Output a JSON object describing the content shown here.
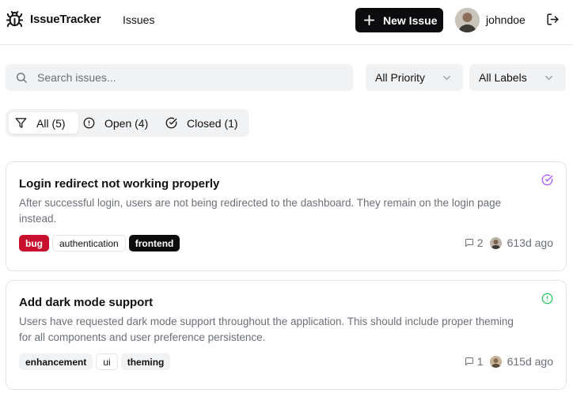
{
  "app": {
    "name": "IssueTracker",
    "nav_issues": "Issues"
  },
  "header": {
    "new_issue_label": "New Issue",
    "username": "johndoe"
  },
  "filters": {
    "search_placeholder": "Search issues...",
    "priority_selected": "All Priority",
    "labels_selected": "All Labels"
  },
  "tabs": [
    {
      "label": "All (5)",
      "active": true,
      "icon": "filter-icon"
    },
    {
      "label": "Open (4)",
      "active": false,
      "icon": "alert-circle-icon"
    },
    {
      "label": "Closed (1)",
      "active": false,
      "icon": "check-circle-icon"
    }
  ],
  "issues": [
    {
      "title": "Login redirect not working properly",
      "description": "After successful login, users are not being redirected to the dashboard. They remain on the login page instead.",
      "status": "closed",
      "status_color": "#a855f7",
      "labels": [
        "bug",
        "authentication",
        "frontend"
      ],
      "comments": "2",
      "age": "613d ago"
    },
    {
      "title": "Add dark mode support",
      "description": "Users have requested dark mode support throughout the application. This should include proper theming for all components and user preference persistence.",
      "status": "open",
      "status_color": "#22c55e",
      "labels": [
        "enhancement",
        "ui",
        "theming"
      ],
      "comments": "1",
      "age": "615d ago"
    }
  ],
  "colors": {
    "primary": "#0c0c0e",
    "bug_label": "#c8102e",
    "muted_bg": "#f1f2f4"
  }
}
